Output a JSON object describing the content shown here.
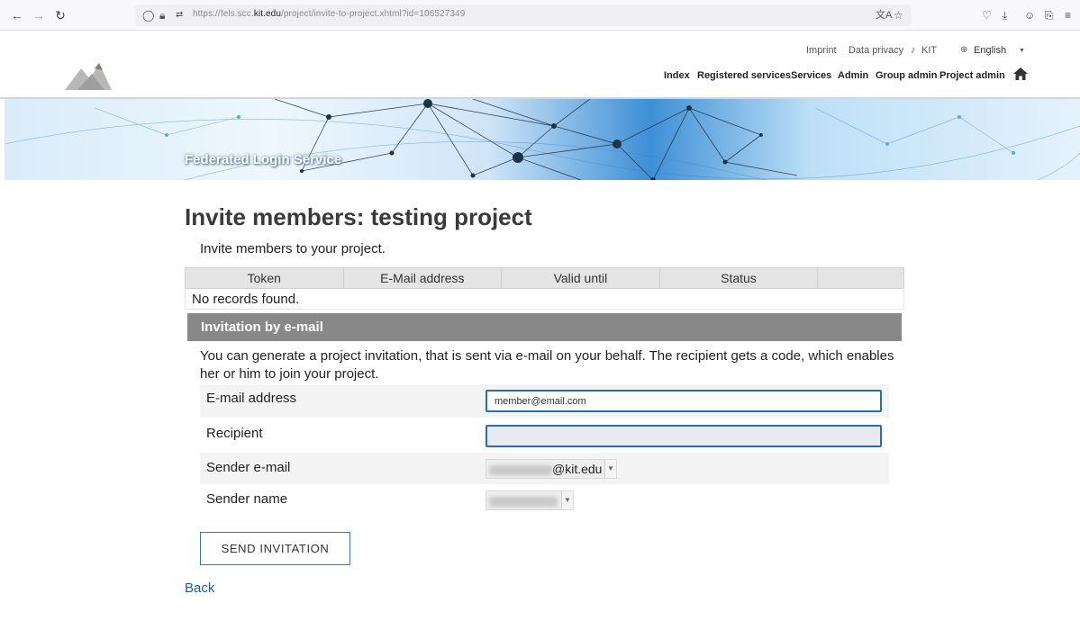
{
  "browser": {
    "url_prefix": "https://fels.scc.",
    "url_domain": "kit.edu",
    "url_path": "/project/invite-to-project.xhtml?id=106527349"
  },
  "header": {
    "top_links": [
      "Imprint",
      "Data privacy",
      "KIT"
    ],
    "language": "English",
    "nav": [
      "Index",
      "Registered services",
      "Services",
      "Admin",
      "Group admin",
      "Project admin"
    ]
  },
  "banner": {
    "title": "Federated Login Service"
  },
  "page": {
    "title": "Invite members: testing project",
    "intro": "Invite members to your project.",
    "table": {
      "columns": [
        "Token",
        "E-Mail address",
        "Valid until",
        "Status"
      ],
      "empty_text": "No records found."
    },
    "invite": {
      "header": "Invitation by e-mail",
      "description": "You can generate a project invitation, that is sent via e-mail on your behalf. The recipient gets a code, which enables her or him to join your project.",
      "email_label": "E-mail address",
      "email_value": "member@email.com",
      "recipient_label": "Recipient",
      "recipient_value": "",
      "sender_email_label": "Sender e-mail",
      "sender_email_suffix": "@kit.edu",
      "sender_name_label": "Sender name",
      "send_button": "SEND INVITATION"
    },
    "back_link": "Back"
  },
  "colors": {
    "panel_header": "#888888",
    "input_border": "#2a6fa8",
    "link": "#1b5d9e"
  }
}
